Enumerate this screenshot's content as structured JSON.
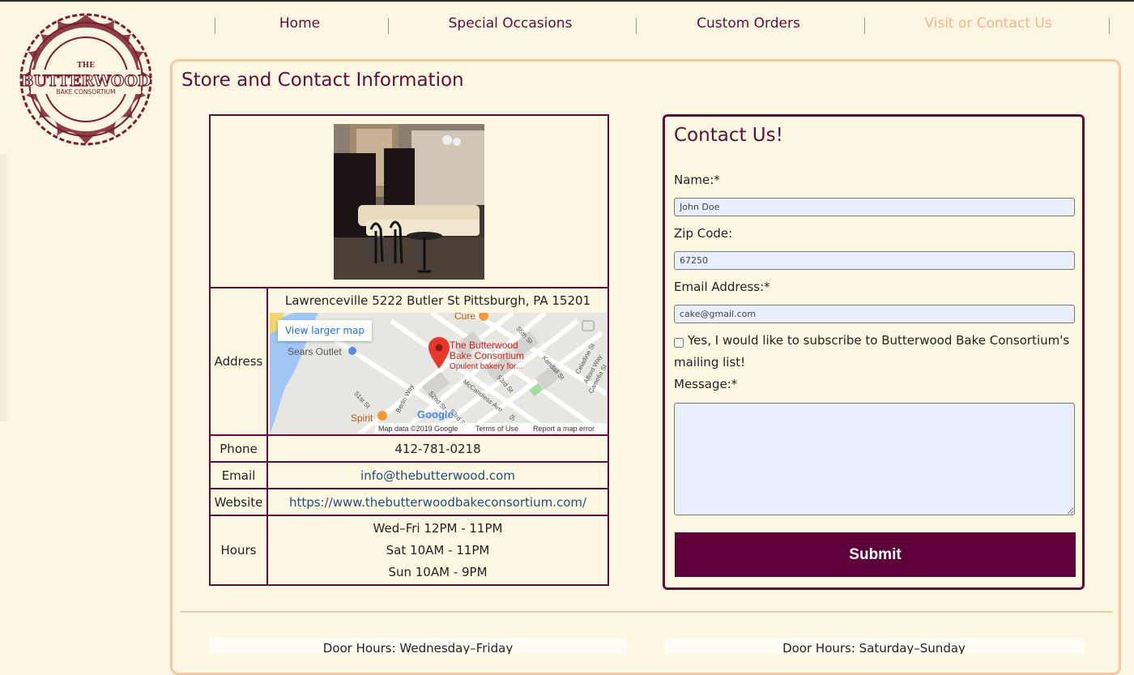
{
  "logo": {
    "text_top": "THE",
    "text_main": "BUTTERWOOD",
    "text_bottom": "BAKE CONSORTIUM"
  },
  "nav": {
    "items": [
      "Home",
      "Special Occasions",
      "Custom Orders",
      "Visit or Contact Us"
    ],
    "active": "Visit or Contact Us"
  },
  "page": {
    "title": "Store and Contact Information"
  },
  "info": {
    "address_label": "Address",
    "address": "Lawrenceville 5222 Butler St Pittsburgh, PA 15201",
    "map": {
      "link": "View larger map",
      "place_name_1": "The Butterwood",
      "place_name_2": "Bake Consortium",
      "place_desc": "Opulent bakery for...",
      "sears": "Sears Outlet",
      "cure": "Cure",
      "spirit": "Spirit",
      "streets": [
        "55th St",
        "Kendall St",
        "Celadine St",
        "Alford Way",
        "Camelia St",
        "53rd St",
        "McCandless Ave",
        "52nd St",
        "Berlin Way",
        "51st St",
        "53rd St",
        "St"
      ],
      "footer_data": "Map data ©2019 Google",
      "footer_terms": "Terms of Use",
      "footer_report": "Report a map error",
      "google": "Google"
    },
    "phone_label": "Phone",
    "phone": "412-781-0218",
    "email_label": "Email",
    "email": "info@thebutterwood.com",
    "website_label": "Website",
    "website": "https://www.thebutterwoodbakeconsortium.com/",
    "hours_label": "Hours",
    "hours": [
      "Wed–Fri 12PM - 11PM",
      "Sat 10AM - 11PM",
      "Sun 10AM - 9PM"
    ]
  },
  "contact": {
    "title": "Contact Us!",
    "name_label": "Name:*",
    "name_placeholder": "John Doe",
    "zip_label": "Zip Code:",
    "zip_placeholder": "67250",
    "email_label": "Email Address:*",
    "email_placeholder": "cake@gmail.com",
    "subscribe_line1": "Yes, I would like to subscribe to Butterwood Bake Consortium's",
    "subscribe_line2": "mailing list!",
    "message_label": "Message:*",
    "submit": "Submit"
  },
  "bottom": {
    "left": "Door Hours: Wednesday–Friday",
    "right": "Door Hours: Saturday–Sunday"
  },
  "colors": {
    "brand": "#5e0e3c",
    "accent": "#f3c9a3",
    "active_nav": "#f0b48c",
    "background": "#fdf6e3"
  }
}
